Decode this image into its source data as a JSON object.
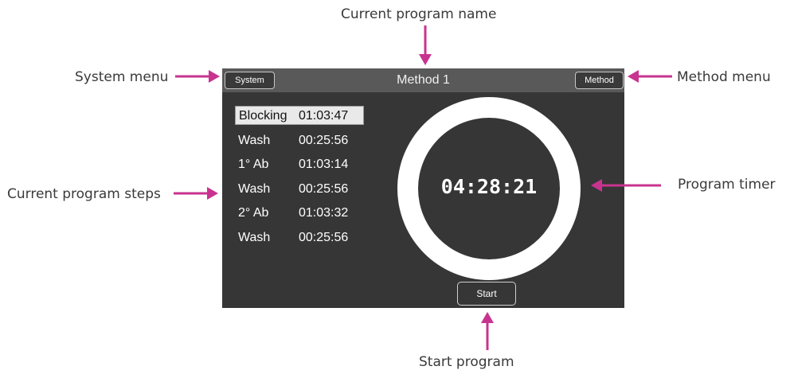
{
  "callouts": {
    "current_program_name": "Current program name",
    "system_menu": "System menu",
    "method_menu": "Method menu",
    "current_program_steps": "Current program steps",
    "program_timer": "Program timer",
    "start_program": "Start program"
  },
  "screen": {
    "system_button": "System",
    "method_button": "Method",
    "title": "Method 1",
    "steps": [
      {
        "name": "Blocking",
        "time": "01:03:47",
        "selected": true
      },
      {
        "name": "Wash",
        "time": "00:25:56"
      },
      {
        "name": "1° Ab",
        "time": "01:03:14"
      },
      {
        "name": "Wash",
        "time": "00:25:56"
      },
      {
        "name": "2° Ab",
        "time": "01:03:32"
      },
      {
        "name": "Wash",
        "time": "00:25:56"
      }
    ],
    "timer": "04:28:21",
    "start_button": "Start"
  },
  "colors": {
    "arrow": "#c8338f",
    "screen_bg": "#363636",
    "titlebar_bg": "#595959",
    "selected_step_bg": "#e9e9e9"
  }
}
